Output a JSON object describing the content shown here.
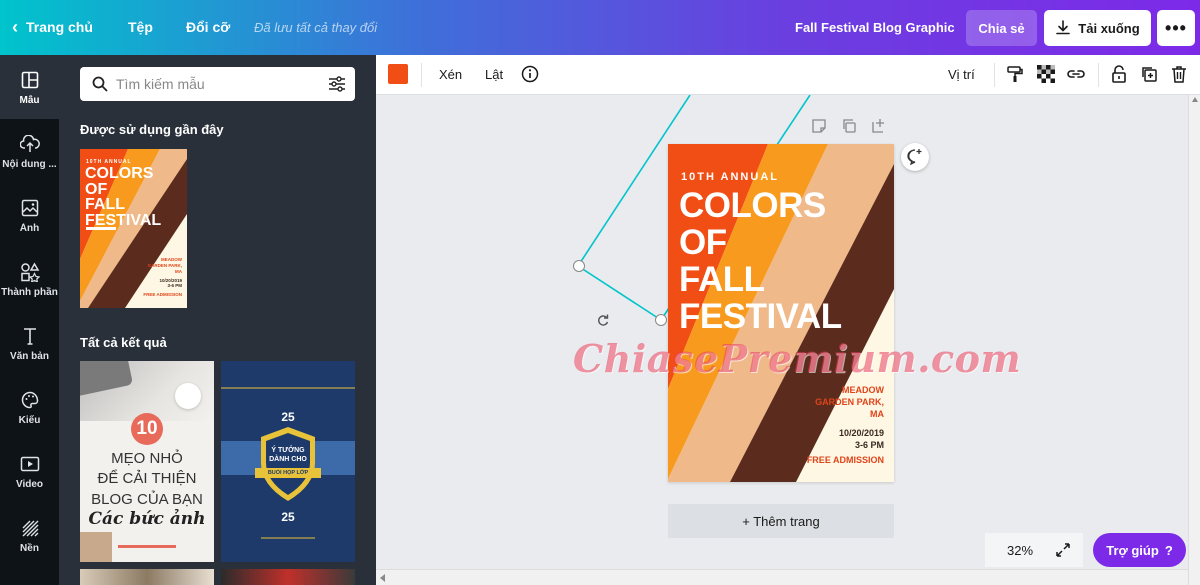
{
  "topbar": {
    "home_label": "Trang chủ",
    "file_label": "Tệp",
    "resize_label": "Đổi cỡ",
    "saved_status": "Đã lưu tất cả thay đổi",
    "document_title": "Fall Festival Blog Graphic",
    "share_label": "Chia sẻ",
    "download_label": "Tải xuống",
    "more_label": "•••",
    "gradient_colors": [
      "#00c4cc",
      "#3f6fd9",
      "#7d2ae8"
    ]
  },
  "rail": {
    "items": [
      {
        "label": "Mẫu",
        "icon": "template-icon"
      },
      {
        "label": "Nội dung ...",
        "icon": "upload-icon"
      },
      {
        "label": "Ảnh",
        "icon": "photo-icon"
      },
      {
        "label": "Thành phần",
        "icon": "elements-icon"
      },
      {
        "label": "Văn bản",
        "icon": "text-icon"
      },
      {
        "label": "Kiểu",
        "icon": "palette-icon"
      },
      {
        "label": "Video",
        "icon": "video-icon"
      },
      {
        "label": "Nền",
        "icon": "background-icon"
      }
    ]
  },
  "panel": {
    "search_placeholder": "Tìm kiếm mẫu",
    "recent_title": "Được sử dụng gần đây",
    "results_title": "Tất cả kết quả",
    "thumb2": {
      "number": "10",
      "line1": "MẸO NHỎ",
      "line2": "ĐỂ CẢI THIỆN",
      "line3": "BLOG CỦA BẠN",
      "line4": "Các bức ảnh"
    },
    "thumb3": {
      "top": "25",
      "l1": "Ý TƯỞNG",
      "l2": "DÀNH CHO",
      "l3": "BUỔI HỌP LỚP",
      "bottom": "25"
    }
  },
  "toolbar": {
    "color": "#f04e14",
    "crop_label": "Xén",
    "flip_label": "Lật",
    "position_label": "Vị trí"
  },
  "poster": {
    "annual": "10TH ANNUAL",
    "title_lines": [
      "COLORS",
      "OF",
      "FALL",
      "FESTIVAL"
    ],
    "location": [
      "MEADOW",
      "GARDEN PARK,",
      "MA"
    ],
    "date": "10/20/2019",
    "time": "3-6 PM",
    "admission": "FREE ADMISSION",
    "colors": [
      "#f04e14",
      "#f89a1d",
      "#efb98a",
      "#5b2c1d",
      "#fdf7e3"
    ]
  },
  "canvas": {
    "add_page_label": "+ Thêm trang",
    "zoom": "32%",
    "help_label": "Trợ giúp",
    "help_icon": "?",
    "watermark": "ChiasePremium.com"
  }
}
